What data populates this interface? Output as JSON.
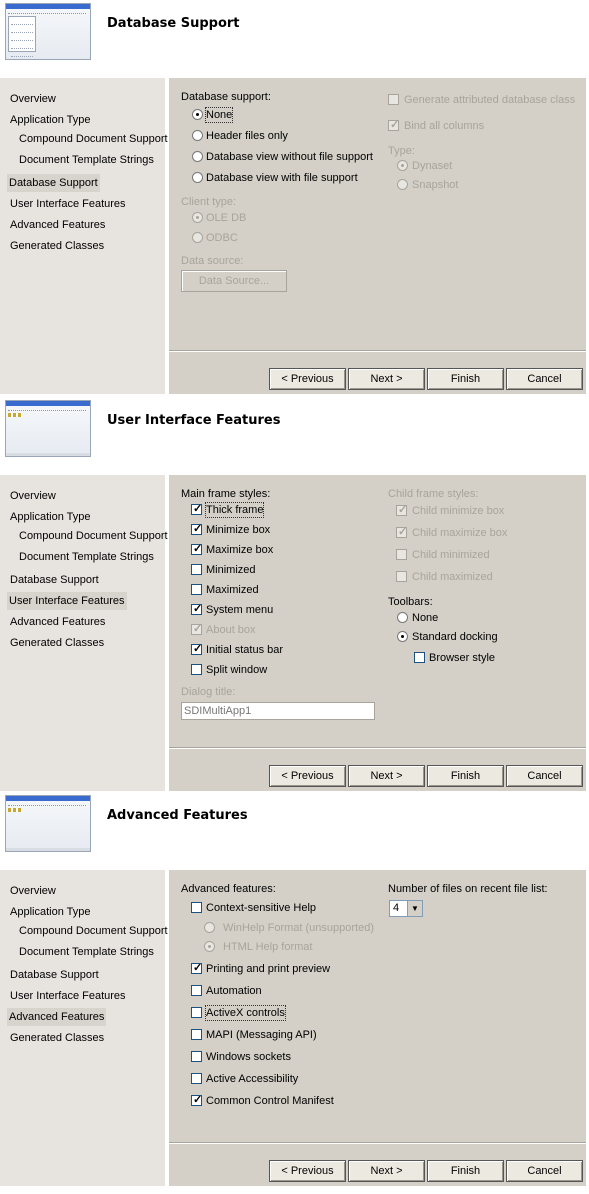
{
  "nav_items": [
    "Overview",
    "Application Type",
    "Compound Document Support",
    "Document Template Strings",
    "Database Support",
    "User Interface Features",
    "Advanced Features",
    "Generated Classes"
  ],
  "buttons": {
    "previous": "< Previous",
    "next": "Next >",
    "finish": "Finish",
    "cancel": "Cancel"
  },
  "panel1": {
    "title": "Database Support",
    "db_support_label": "Database support:",
    "db_options": [
      "None",
      "Header files only",
      "Database view without file support",
      "Database view with file support"
    ],
    "db_selected": "None",
    "client_type_label": "Client type:",
    "client_options": [
      "OLE DB",
      "ODBC"
    ],
    "data_source_label": "Data source:",
    "data_source_button": "Data Source...",
    "gen_attr_class": "Generate attributed database class",
    "bind_all_columns": "Bind all columns",
    "type_label": "Type:",
    "type_options": [
      "Dynaset",
      "Snapshot"
    ]
  },
  "panel2": {
    "title": "User Interface Features",
    "main_frame_label": "Main frame styles:",
    "main_frame_styles": [
      {
        "label": "Thick frame",
        "checked": true,
        "disabled": false
      },
      {
        "label": "Minimize box",
        "checked": true,
        "disabled": false
      },
      {
        "label": "Maximize box",
        "checked": true,
        "disabled": false
      },
      {
        "label": "Minimized",
        "checked": false,
        "disabled": false
      },
      {
        "label": "Maximized",
        "checked": false,
        "disabled": false
      },
      {
        "label": "System menu",
        "checked": true,
        "disabled": false
      },
      {
        "label": "About box",
        "checked": true,
        "disabled": true
      },
      {
        "label": "Initial status bar",
        "checked": true,
        "disabled": false
      },
      {
        "label": "Split window",
        "checked": false,
        "disabled": false
      }
    ],
    "dialog_title_label": "Dialog title:",
    "dialog_title_value": "SDIMultiApp1",
    "child_frame_label": "Child frame styles:",
    "child_frame_styles": [
      {
        "label": "Child minimize box",
        "checked": true
      },
      {
        "label": "Child maximize box",
        "checked": true
      },
      {
        "label": "Child minimized",
        "checked": false
      },
      {
        "label": "Child maximized",
        "checked": false
      }
    ],
    "toolbars_label": "Toolbars:",
    "toolbar_options": [
      "None",
      "Standard docking"
    ],
    "toolbar_selected": "Standard docking",
    "browser_style": "Browser style"
  },
  "panel3": {
    "title": "Advanced Features",
    "adv_label": "Advanced features:",
    "context_help": "Context-sensitive Help",
    "help_formats": [
      "WinHelp Format (unsupported)",
      "HTML Help format"
    ],
    "features": [
      {
        "label": "Printing and print preview",
        "checked": true
      },
      {
        "label": "Automation",
        "checked": false
      },
      {
        "label": "ActiveX controls",
        "checked": false
      },
      {
        "label": "MAPI (Messaging API)",
        "checked": false
      },
      {
        "label": "Windows sockets",
        "checked": false
      },
      {
        "label": "Active Accessibility",
        "checked": false
      },
      {
        "label": "Common Control Manifest",
        "checked": true
      }
    ],
    "recent_files_label": "Number of files on recent file list:",
    "recent_files_value": "4"
  }
}
